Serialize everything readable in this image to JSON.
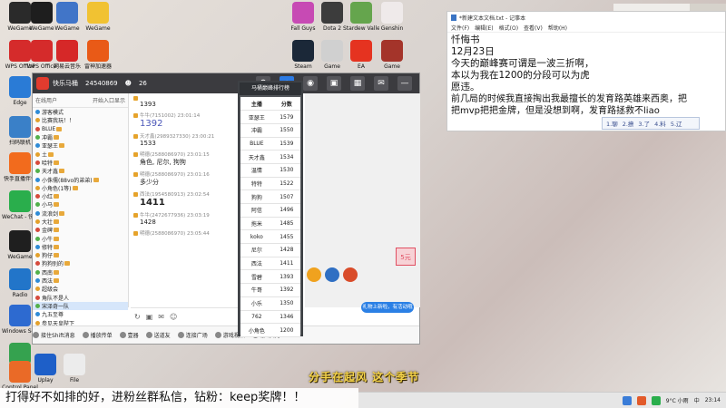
{
  "desktop": {
    "icons_left": [
      {
        "label": "WeGame",
        "color": "#2a2a2a"
      },
      {
        "label": "WPS Office",
        "color": "#d52b2b"
      },
      {
        "label": "Edge",
        "color": "#2a7bd6"
      },
      {
        "label": "扫码联机",
        "color": "#3a80c8"
      },
      {
        "label": "快手直播伴侣",
        "color": "#f26b1d"
      },
      {
        "label": "WeChat - 快捷方式",
        "color": "#2aae4c"
      },
      {
        "label": "WeGame",
        "color": "#1f1f1f"
      },
      {
        "label": "Radio",
        "color": "#2275c9"
      },
      {
        "label": "Windows Security",
        "color": "#2d6ad0"
      },
      {
        "label": "A.NE.IN",
        "color": "#35a24f"
      },
      {
        "label": "Control Panel",
        "color": "#ea6a27"
      }
    ],
    "icons_top": [
      {
        "label": "WeGame",
        "color": "#1e1e1e"
      },
      {
        "label": "WeGame",
        "color": "#4175c8"
      },
      {
        "label": "WeGame",
        "color": "#f1c232"
      },
      {
        "label": "WPS Office",
        "color": "#d52b2b"
      },
      {
        "label": "网易云音乐",
        "color": "#d62828"
      },
      {
        "label": "雷神加速器",
        "color": "#e95a17"
      }
    ],
    "icons_mid": [
      {
        "label": "Fall Guys",
        "color": "#c74ab4"
      },
      {
        "label": "Dota 2",
        "color": "#3c3c3c"
      },
      {
        "label": "Stardew Valley",
        "color": "#65a54d"
      },
      {
        "label": "Genshin",
        "color": "#efeaea"
      },
      {
        "label": "Steam",
        "color": "#1b2838"
      },
      {
        "label": "Game",
        "color": "#d0d0d0"
      },
      {
        "label": "EA",
        "color": "#e53320"
      },
      {
        "label": "Game",
        "color": "#a4342a"
      }
    ],
    "icons_bottom": [
      {
        "label": "Uplay",
        "color": "#1e5fc8"
      },
      {
        "label": "File",
        "color": "#ececec"
      }
    ]
  },
  "app": {
    "title": "快乐马桶",
    "room_id": "24540869",
    "viewers": "26",
    "userlist_header": "在线用户",
    "userlist_subheader": "开始入口显示",
    "users": [
      "游客模式",
      "比赛我玩！！",
      "BLUE",
      "冲霸",
      "亚瑟王",
      "土",
      "哈特",
      "天才鑫",
      "小侏儒(88vo的弟弟)",
      "小角色(1等)",
      "小红",
      "小马",
      "流浪剑",
      "大壮",
      "金碑",
      "小牛",
      "修特",
      "狗仔",
      "狗狗别的",
      "西南",
      "西法",
      "超级会",
      "角队不是人",
      "宋泽奇一队",
      "九五至尊",
      "参见天皇陛下"
    ],
    "chat": [
      {
        "who": "",
        "text": "1393",
        "style": "normal"
      },
      {
        "who": "牛牛(7151002)  23:01:14",
        "text": "1392",
        "style": "big blue"
      },
      {
        "who": "天才鑫(2989327330)  23:00:21",
        "text": "1533",
        "style": "normal"
      },
      {
        "who": "明德(2588086970)  23:01:15",
        "text": "角色, 尼尔, 狗狗",
        "style": "normal"
      },
      {
        "who": "明德(2588086970)  23:01:16",
        "text": "多少分",
        "style": "normal"
      },
      {
        "who": "西法(1954580913)  23:02:54",
        "text": "1411",
        "style": "big dark"
      },
      {
        "who": "牛牛(2472677936)  23:03:19",
        "text": "1428",
        "style": "normal"
      },
      {
        "who": "明德(2588086970)  23:05:44",
        "text": "",
        "style": "normal"
      }
    ],
    "bottom_bar": [
      "接住Shift消息",
      "播放传单",
      "壹器",
      "送道友",
      "连接广场",
      "游戏视频",
      "游戏助手"
    ],
    "video_notice": "礼物上新啦，有活动哦"
  },
  "leaderboard": {
    "title": "马桶巅峰排行榜",
    "headers": [
      "主播",
      "分数"
    ],
    "rows": [
      [
        "亚瑟王",
        "1579"
      ],
      [
        "冲霸",
        "1550"
      ],
      [
        "BLUE",
        "1539"
      ],
      [
        "天才鑫",
        "1534"
      ],
      [
        "温情",
        "1530"
      ],
      [
        "特特",
        "1522"
      ],
      [
        "狗狗",
        "1507"
      ],
      [
        "阿信",
        "1496"
      ],
      [
        "拖米",
        "1485"
      ],
      [
        "koko",
        "1455"
      ],
      [
        "尼尔",
        "1428"
      ],
      [
        "西法",
        "1411"
      ],
      [
        "雪碧",
        "1393"
      ],
      [
        "牛哥",
        "1392"
      ],
      [
        "小乐",
        "1350"
      ],
      [
        "762",
        "1346"
      ],
      [
        "小角色",
        "1200"
      ]
    ]
  },
  "notepad": {
    "title": "*新建文本文档.txt - 记事本",
    "menu": [
      "文件(F)",
      "编辑(E)",
      "格式(O)",
      "查看(V)",
      "帮助(H)"
    ],
    "lines": [
      "忏悔书",
      "12月23日",
      "今天的巅峰赛可谓是一波三折啊，",
      "本以为我在1200的分段可以为虎",
      "愿违。",
      "前几局的时候我直接掏出我最擅长的发育路英雄来西奥，把",
      "把mvp把把金牌，但是没想到啊，发育路拯救不liao"
    ],
    "ime_candidates": [
      "1.聊",
      "2.撩",
      "3.了",
      "4.料",
      "5.辽"
    ]
  },
  "caption": "分手在起风 这个季节",
  "marquee": "打得好不如排的好，进粉丝群私信，钻粉：keep奖牌！！",
  "taskbar": {
    "weather": "9°C 小雨",
    "ime": "中",
    "time": "23:14"
  }
}
